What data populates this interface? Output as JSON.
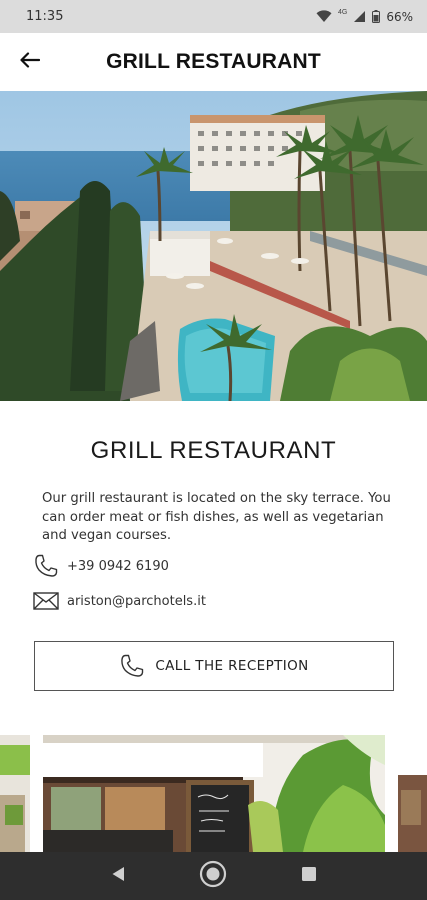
{
  "status_bar": {
    "time": "11:35",
    "network": "4G",
    "battery": "66%"
  },
  "app_bar": {
    "title": "GRILL RESTAURANT",
    "back_icon": "arrow-left-icon"
  },
  "content": {
    "title": "GRILL RESTAURANT",
    "description": "Our grill restaurant is located on the sky terrace. You can order meat or fish dishes, as well as vegetarian and vegan courses.",
    "phone": "+39 0942 6190",
    "email": "ariston@parchotels.it",
    "call_button_label": "CALL THE RECEPTION"
  },
  "nav_bar": {
    "items": [
      "back-triangle-icon",
      "home-circle-icon",
      "recents-square-icon"
    ]
  },
  "colors": {
    "status_bar_bg": "#dcdcdc",
    "nav_bar_bg": "#2e2e2e",
    "text_dark": "#1a1a1a",
    "button_border": "#555555"
  }
}
